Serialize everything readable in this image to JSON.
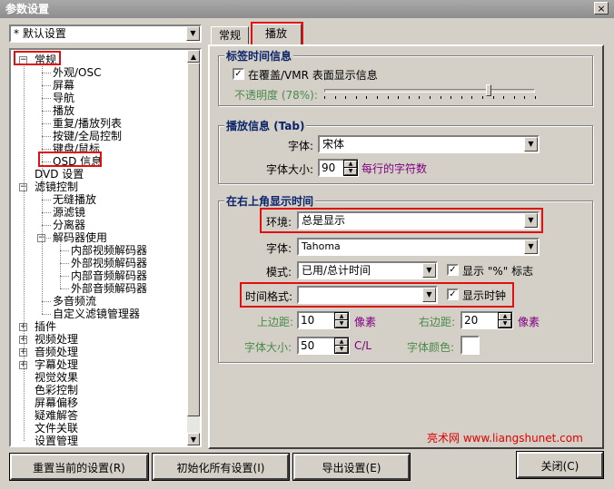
{
  "window": {
    "title": "参数设置",
    "close_glyph": "×"
  },
  "profile": {
    "value": "* 默认设置"
  },
  "tree": {
    "items": [
      {
        "label": "常规",
        "expander": "−"
      },
      {
        "label": "外观/OSC"
      },
      {
        "label": "屏幕"
      },
      {
        "label": "导航"
      },
      {
        "label": "播放"
      },
      {
        "label": "重复/播放列表"
      },
      {
        "label": "按键/全局控制"
      },
      {
        "label": "键盘/鼠标"
      },
      {
        "label": "OSD 信息"
      },
      {
        "label": "DVD 设置"
      },
      {
        "label": "滤镜控制",
        "expander": "−"
      },
      {
        "label": "无缝播放"
      },
      {
        "label": "源滤镜"
      },
      {
        "label": "分离器"
      },
      {
        "label": "解码器使用",
        "expander": "−"
      },
      {
        "label": "内部视频解码器"
      },
      {
        "label": "外部视频解码器"
      },
      {
        "label": "内部音频解码器"
      },
      {
        "label": "外部音频解码器"
      },
      {
        "label": "多音频流"
      },
      {
        "label": "自定义滤镜管理器"
      },
      {
        "label": "插件",
        "expander": "+"
      },
      {
        "label": "视频处理",
        "expander": "+"
      },
      {
        "label": "音频处理",
        "expander": "+"
      },
      {
        "label": "字幕处理",
        "expander": "+"
      },
      {
        "label": "视觉效果"
      },
      {
        "label": "色彩控制"
      },
      {
        "label": "屏幕偏移"
      },
      {
        "label": "疑难解答"
      },
      {
        "label": "文件关联"
      },
      {
        "label": "设置管理"
      }
    ]
  },
  "tabs": [
    {
      "label": "常规"
    },
    {
      "label": "播放"
    }
  ],
  "group1": {
    "title": "标签时间信息",
    "checkbox_label": "在覆盖/VMR 表面显示信息",
    "checked": true,
    "opacity_label": "不透明度 (78%):",
    "opacity_value": 0.78
  },
  "group2": {
    "title": "播放信息 (Tab)",
    "font_label": "字体:",
    "font_value": "宋体",
    "size_label": "字体大小:",
    "size_value": "90",
    "size_suffix": "每行的字符数"
  },
  "group3": {
    "title": "在右上角显示时间",
    "env_label": "环境:",
    "env_value": "总是显示",
    "font_label": "字体:",
    "font_value": "Tahoma",
    "mode_label": "模式:",
    "mode_value": "已用/总计时间",
    "show_pct_label": "显示 \"%\" 标志",
    "timefmt_label": "时间格式:",
    "timefmt_value": "",
    "show_clock_label": "显示时钟",
    "top_label": "上边距:",
    "top_value": "10",
    "right_label": "右边距:",
    "right_value": "20",
    "unit_px": "像素",
    "fsize_label": "字体大小:",
    "fsize_value": "50",
    "fsize_unit": "C/L",
    "color_label": "字体颜色:"
  },
  "buttons": {
    "reset": "重置当前的设置(R)",
    "init": "初始化所有设置(I)",
    "export": "导出设置(E)",
    "close": "关闭(C)"
  },
  "watermark": "亮术网 www.liangshunet.com",
  "colors": {
    "highlight_red": "#e01010",
    "purple_text": "#800080",
    "group_title": "#0a246a"
  },
  "icons": {
    "checkbox": "✓",
    "dropdown": "▼",
    "up": "▲",
    "down": "▼"
  }
}
